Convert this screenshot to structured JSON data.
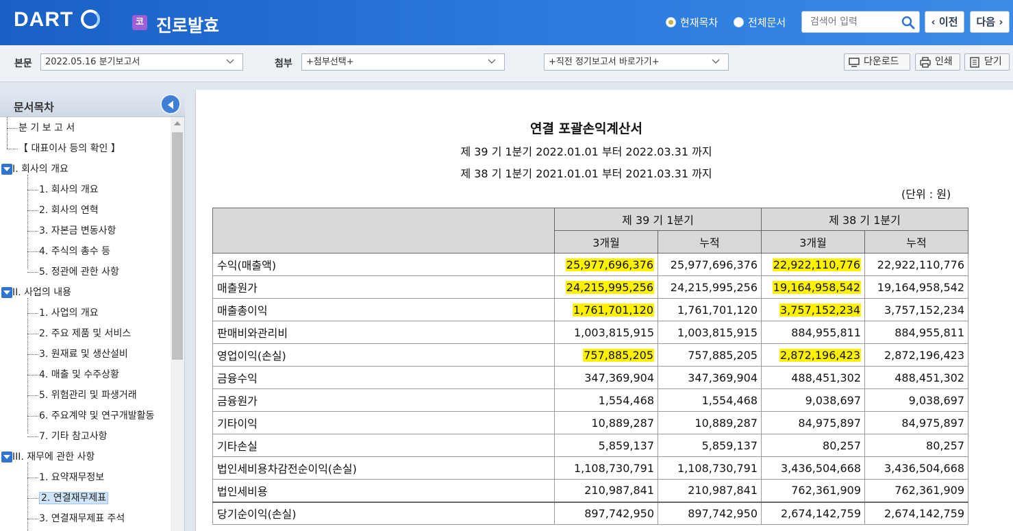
{
  "header": {
    "logo": "DART",
    "corp_badge": "코",
    "corp_name": "진로발효",
    "scope_current": "현재목차",
    "scope_all": "전체문서",
    "search_placeholder": "검색어 입력",
    "prev_label": "이전",
    "next_label": "다음"
  },
  "toolbar": {
    "main_label": "본문",
    "main_select": "2022.05.16  분기보고서",
    "attach_label": "첨부",
    "attach_select": "+첨부선택+",
    "recent_select": "+직전 정기보고서 바로가기+",
    "download_label": "다운로드",
    "print_label": "인쇄",
    "close_label": "닫기"
  },
  "sidebar": {
    "title": "문서목차",
    "items": [
      {
        "label": "분 기 보 고 서"
      },
      {
        "label": "【 대표이사 등의 확인 】"
      },
      {
        "label": "I. 회사의 개요"
      },
      {
        "label": "1. 회사의 개요"
      },
      {
        "label": "2. 회사의 연혁"
      },
      {
        "label": "3. 자본금 변동사항"
      },
      {
        "label": "4. 주식의 총수 등"
      },
      {
        "label": "5. 정관에 관한 사항"
      },
      {
        "label": "II. 사업의 내용"
      },
      {
        "label": "1. 사업의 개요"
      },
      {
        "label": "2. 주요 제품 및 서비스"
      },
      {
        "label": "3. 원재료 및 생산설비"
      },
      {
        "label": "4. 매출 및 수주상황"
      },
      {
        "label": "5. 위험관리 및 파생거래"
      },
      {
        "label": "6. 주요계약 및 연구개발활동"
      },
      {
        "label": "7. 기타 참고사항"
      },
      {
        "label": "III. 재무에 관한 사항"
      },
      {
        "label": "1. 요약재무정보"
      },
      {
        "label": "2. 연결재무제표"
      },
      {
        "label": "3. 연결재무제표 주석"
      }
    ]
  },
  "document": {
    "title": "연결  포괄손익계산서",
    "period_current": "제 39 기 1분기 2022.01.01 부터 2022.03.31 까지",
    "period_prior": "제 38 기 1분기 2021.01.01 부터 2021.03.31 까지",
    "unit": "(단위 : 원)",
    "head_current": "제 39 기 1분기",
    "head_prior": "제 38 기 1분기",
    "sub_3m": "3개월",
    "sub_cum": "누적",
    "sub_3m_2": "3개월",
    "sub_cum_2": "누적",
    "rows": [
      {
        "label": "수익(매출액)",
        "c3": "25,977,696,376",
        "ccum": "25,977,696,376",
        "p3": "22,922,110,776",
        "pcum": "22,922,110,776"
      },
      {
        "label": "매출원가",
        "c3": "24,215,995,256",
        "ccum": "24,215,995,256",
        "p3": "19,164,958,542",
        "pcum": "19,164,958,542"
      },
      {
        "label": "매출총이익",
        "c3": "1,761,701,120",
        "ccum": "1,761,701,120",
        "p3": "3,757,152,234",
        "pcum": "3,757,152,234"
      },
      {
        "label": "판매비와관리비",
        "c3": "1,003,815,915",
        "ccum": "1,003,815,915",
        "p3": "884,955,811",
        "pcum": "884,955,811"
      },
      {
        "label": "영업이익(손실)",
        "c3": "757,885,205",
        "ccum": "757,885,205",
        "p3": "2,872,196,423",
        "pcum": "2,872,196,423"
      },
      {
        "label": "금융수익",
        "c3": "347,369,904",
        "ccum": "347,369,904",
        "p3": "488,451,302",
        "pcum": "488,451,302"
      },
      {
        "label": "금융원가",
        "c3": "1,554,468",
        "ccum": "1,554,468",
        "p3": "9,038,697",
        "pcum": "9,038,697"
      },
      {
        "label": "기타이익",
        "c3": "10,889,287",
        "ccum": "10,889,287",
        "p3": "84,975,897",
        "pcum": "84,975,897"
      },
      {
        "label": "기타손실",
        "c3": "5,859,137",
        "ccum": "5,859,137",
        "p3": "80,257",
        "pcum": "80,257"
      },
      {
        "label": "법인세비용차감전순이익(손실)",
        "c3": "1,108,730,791",
        "ccum": "1,108,730,791",
        "p3": "3,436,504,668",
        "pcum": "3,436,504,668"
      },
      {
        "label": "법인세비용",
        "c3": "210,987,841",
        "ccum": "210,987,841",
        "p3": "762,361,909",
        "pcum": "762,361,909"
      },
      {
        "label": "당기순이익(손실)",
        "c3": "897,742,950",
        "ccum": "897,742,950",
        "p3": "2,674,142,759",
        "pcum": "2,674,142,759"
      }
    ]
  },
  "colors": {
    "header_blue": "#2a78dc",
    "highlight": "#fff200",
    "selected_bg": "#cfe5fb"
  }
}
